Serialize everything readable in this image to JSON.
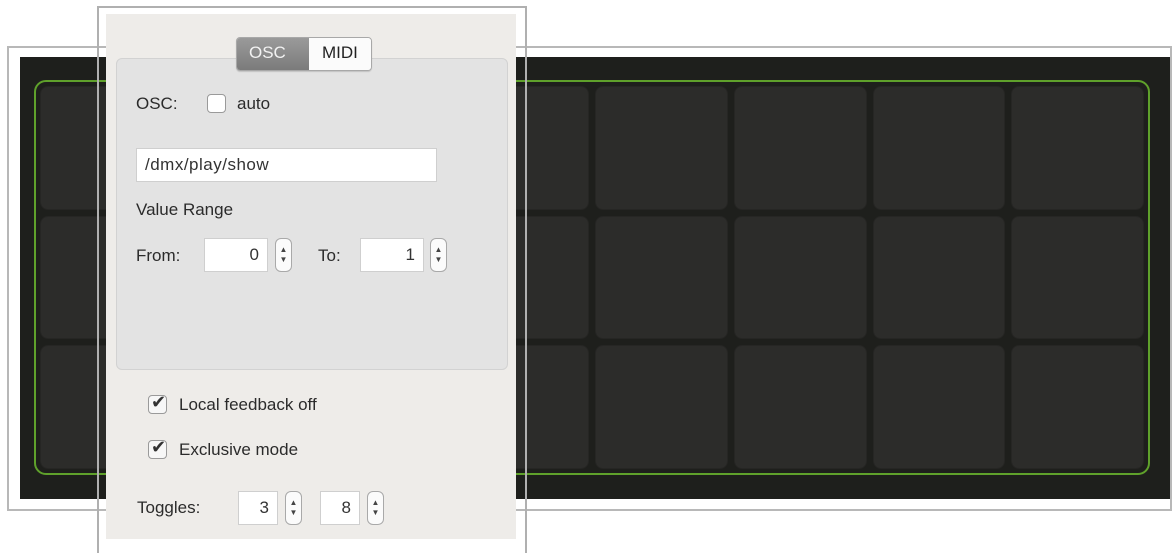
{
  "tabs": {
    "osc_label": "OSC",
    "midi_label": "MIDI"
  },
  "osc": {
    "label": "OSC:",
    "auto_label": "auto",
    "auto_checked": false,
    "address_value": "/dmx/play/show"
  },
  "value_range": {
    "title": "Value Range",
    "from_label": "From:",
    "from_value": "0",
    "to_label": "To:",
    "to_value": "1"
  },
  "options": {
    "local_feedback_label": "Local feedback off",
    "local_feedback_checked": true,
    "exclusive_mode_label": "Exclusive mode",
    "exclusive_mode_checked": true
  },
  "toggles": {
    "label": "Toggles:",
    "columns_value": "3",
    "rows_value": "8"
  },
  "grid": {
    "rows": 3,
    "columns": 8,
    "outline_color": "#5fa12b",
    "background_color": "#1e1f1c"
  }
}
